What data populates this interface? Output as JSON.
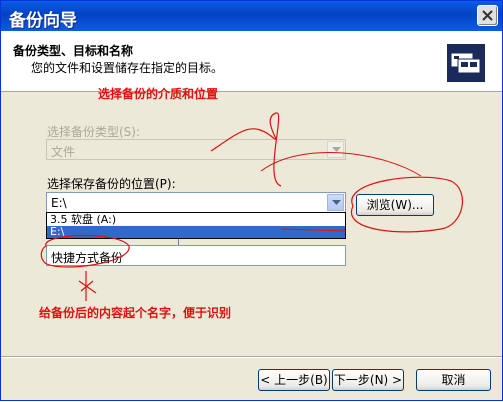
{
  "window": {
    "title": "备份向导"
  },
  "header": {
    "title": "备份类型、目标和名称",
    "subtitle": "您的文件和设置储存在指定的目标。",
    "icon": "backup-cards-icon"
  },
  "annotations": {
    "top": "选择备份的介质和位置",
    "bottom": "给备份后的内容起个名字，便于识别"
  },
  "backup_type": {
    "label": "选择备份类型(S):",
    "value": "文件",
    "disabled": true
  },
  "location": {
    "label": "选择保存备份的位置(P):",
    "value": "E:\\"
  },
  "browse_button": "浏览(W)...",
  "location_options": [
    "3.5 软盘 (A:)",
    "E:\\"
  ],
  "location_selected": "E:\\",
  "name": {
    "label": "快捷方式备份"
  },
  "buttons": {
    "back": "< 上一步(B)",
    "next": "下一步(N) >",
    "cancel": "取消"
  },
  "colors": {
    "title_bar": "#0a5ce6",
    "annotation": "#e01010",
    "selection": "#316ac5"
  }
}
